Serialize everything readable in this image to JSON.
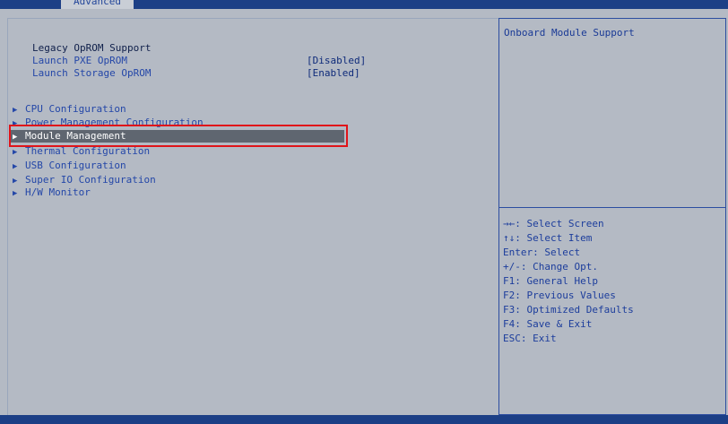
{
  "header": {
    "active_tab": "Advanced"
  },
  "legacy": {
    "heading": "Legacy OpROM Support",
    "settings": [
      {
        "label": "Launch PXE OpROM",
        "value": "[Disabled]"
      },
      {
        "label": "Launch Storage OpROM",
        "value": "[Enabled]"
      }
    ]
  },
  "submenus": [
    {
      "label": "CPU Configuration"
    },
    {
      "label": "Power Management Configuration"
    },
    {
      "label": "Module Management"
    },
    {
      "label": "Thermal Configuration"
    },
    {
      "label": "USB Configuration"
    },
    {
      "label": "Super IO Configuration"
    },
    {
      "label": "H/W Monitor"
    }
  ],
  "selected_index": 2,
  "help": {
    "description": "Onboard Module Support",
    "keys": [
      "→←: Select Screen",
      "↑↓: Select Item",
      "Enter: Select",
      "+/-: Change Opt.",
      "F1: General Help",
      "F2: Previous Values",
      "F3: Optimized Defaults",
      "F4: Save & Exit",
      "ESC: Exit"
    ]
  },
  "colors": {
    "background": "#b4bac4",
    "bar": "#1c3f86",
    "highlight": "#5f6670",
    "annotation": "#e0141a"
  },
  "icons": {
    "submenu_arrow": "triangle-right-icon"
  }
}
